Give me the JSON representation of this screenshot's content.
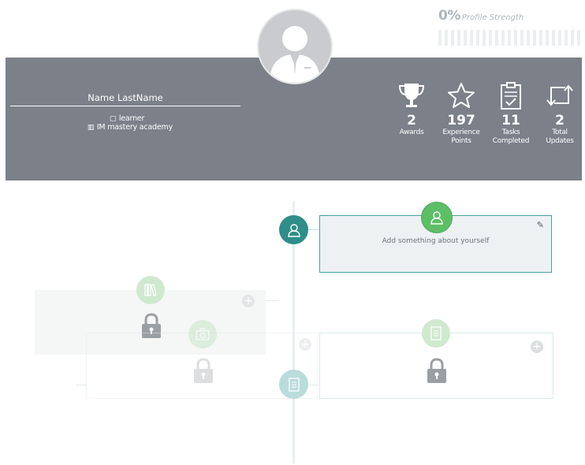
{
  "profile_strength": {
    "percent": "0%",
    "label": "Profile Strength",
    "value": 0
  },
  "user": {
    "name": "Name LastName",
    "role": "learner",
    "organization": "IM mastery academy"
  },
  "stats": [
    {
      "icon": "trophy-icon",
      "value": "2",
      "label_line1": "Awards",
      "label_line2": ""
    },
    {
      "icon": "star-icon",
      "value": "197",
      "label_line1": "Experience",
      "label_line2": "Points"
    },
    {
      "icon": "clipboard-check-icon",
      "value": "11",
      "label_line1": "Tasks",
      "label_line2": "Completed"
    },
    {
      "icon": "repost-icon",
      "value": "2",
      "label_line1": "Total",
      "label_line2": "Updates"
    }
  ],
  "timeline": {
    "about_placeholder": "Add something about yourself"
  },
  "colors": {
    "banner": "#7b8089",
    "teal_accent": "#2f8e89",
    "green_badge": "#5cbf66",
    "faded_green": "#cfe9cf"
  }
}
